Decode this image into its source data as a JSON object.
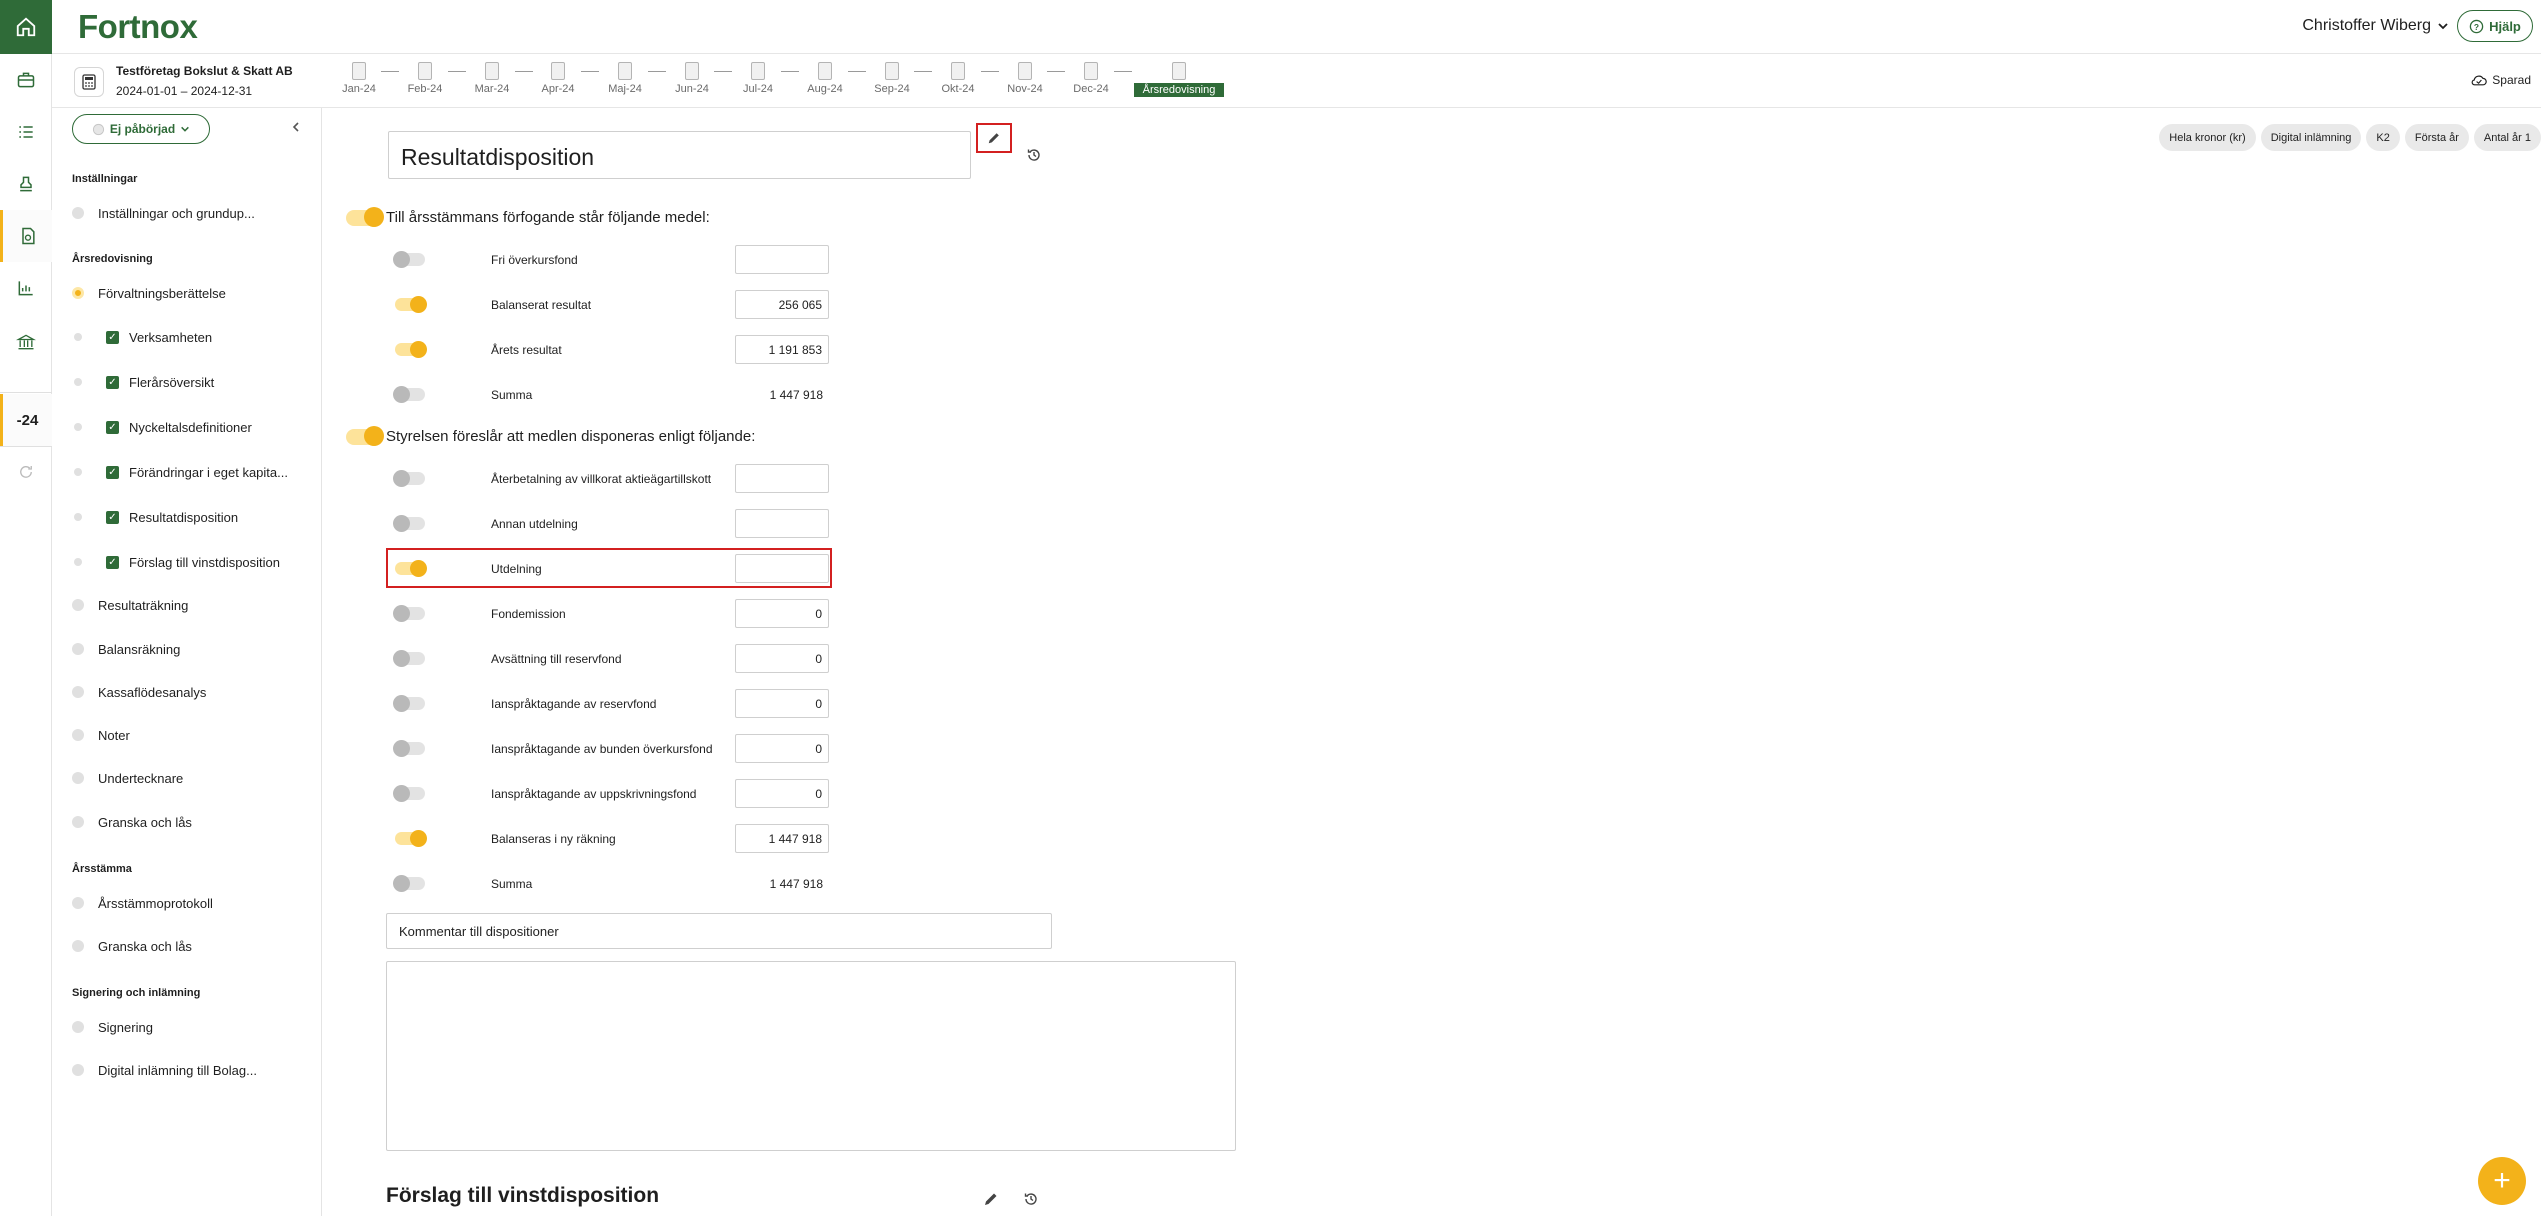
{
  "app": {
    "logo": "Fortnox",
    "user": "Christoffer Wiberg",
    "help": "Hjälp"
  },
  "company": {
    "name": "Testföretag Bokslut & Skatt AB",
    "period": "2024-01-01 – 2024-12-31",
    "saved": "Sparad"
  },
  "months": [
    "Jan-24",
    "Feb-24",
    "Mar-24",
    "Apr-24",
    "Maj-24",
    "Jun-24",
    "Jul-24",
    "Aug-24",
    "Sep-24",
    "Okt-24",
    "Nov-24",
    "Dec-24",
    "Årsredovisning"
  ],
  "rail": {
    "year": "-24"
  },
  "sidebar": {
    "status": "Ej påbörjad",
    "sec_installningar": "Inställningar",
    "installningar_item": "Inställningar och grundup...",
    "sec_arsredovisning": "Årsredovisning",
    "forvaltning": "Förvaltningsberättelse",
    "sub": [
      "Verksamheten",
      "Flerårsöversikt",
      "Nyckeltalsdefinitioner",
      "Förändringar i eget kapita...",
      "Resultatdisposition",
      "Förslag till vinstdisposition"
    ],
    "items": [
      "Resultaträkning",
      "Balansräkning",
      "Kassaflödesanalys",
      "Noter",
      "Undertecknare",
      "Granska och lås"
    ],
    "sec_arsstamma": "Årsstämma",
    "arsstamma_items": [
      "Årsstämmoprotokoll",
      "Granska och lås"
    ],
    "sec_signering": "Signering och inlämning",
    "signering_items": [
      "Signering",
      "Digital inlämning till Bolag..."
    ]
  },
  "main": {
    "title": "Resultatdisposition",
    "chips": [
      "Hela kronor (kr)",
      "Digital inlämning",
      "K2",
      "Första år",
      "Antal år 1"
    ],
    "head1": "Till årsstämmans förfogande står följande medel:",
    "group1": [
      {
        "label": "Fri överkursfond",
        "value": "",
        "on": false
      },
      {
        "label": "Balanserat resultat",
        "value": "256 065",
        "on": true
      },
      {
        "label": "Årets resultat",
        "value": "1 191 853",
        "on": true
      },
      {
        "label": "Summa",
        "value": "1 447 918",
        "on": false
      }
    ],
    "head2": "Styrelsen föreslår att medlen disponeras enligt följande:",
    "group2": [
      {
        "label": "Återbetalning av villkorat aktieägartillskott",
        "value": "",
        "on": false
      },
      {
        "label": "Annan utdelning",
        "value": "",
        "on": false
      },
      {
        "label": "Utdelning",
        "value": "",
        "on": true
      },
      {
        "label": "Fondemission",
        "value": "0",
        "on": false
      },
      {
        "label": "Avsättning till reservfond",
        "value": "0",
        "on": false
      },
      {
        "label": "Ianspråktagande av reservfond",
        "value": "0",
        "on": false
      },
      {
        "label": "Ianspråktagande av bunden överkursfond",
        "value": "0",
        "on": false
      },
      {
        "label": "Ianspråktagande av uppskrivningsfond",
        "value": "0",
        "on": false
      },
      {
        "label": "Balanseras i ny räkning",
        "value": "1 447 918",
        "on": true
      },
      {
        "label": "Summa",
        "value": "1 447 918",
        "on": false
      }
    ],
    "comment_label": "Kommentar till dispositioner",
    "comment_value": "",
    "next_section": "Förslag till vinstdisposition",
    "fab": "+"
  }
}
